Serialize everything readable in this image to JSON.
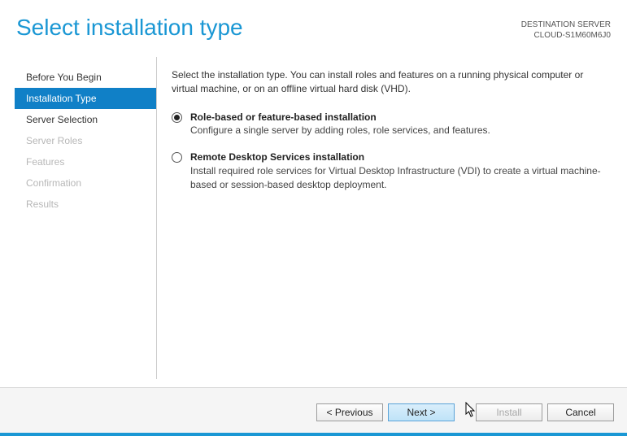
{
  "header": {
    "title": "Select installation type",
    "dest_label": "DESTINATION SERVER",
    "dest_server": "CLOUD-S1M60M6J0"
  },
  "sidebar": {
    "items": [
      {
        "label": "Before You Begin",
        "state": "normal"
      },
      {
        "label": "Installation Type",
        "state": "active"
      },
      {
        "label": "Server Selection",
        "state": "normal"
      },
      {
        "label": "Server Roles",
        "state": "disabled"
      },
      {
        "label": "Features",
        "state": "disabled"
      },
      {
        "label": "Confirmation",
        "state": "disabled"
      },
      {
        "label": "Results",
        "state": "disabled"
      }
    ]
  },
  "content": {
    "intro": "Select the installation type. You can install roles and features on a running physical computer or virtual machine, or on an offline virtual hard disk (VHD).",
    "options": [
      {
        "title": "Role-based or feature-based installation",
        "desc": "Configure a single server by adding roles, role services, and features.",
        "selected": true
      },
      {
        "title": "Remote Desktop Services installation",
        "desc": "Install required role services for Virtual Desktop Infrastructure (VDI) to create a virtual machine-based or session-based desktop deployment.",
        "selected": false
      }
    ]
  },
  "footer": {
    "previous": "< Previous",
    "next": "Next >",
    "install": "Install",
    "cancel": "Cancel"
  }
}
